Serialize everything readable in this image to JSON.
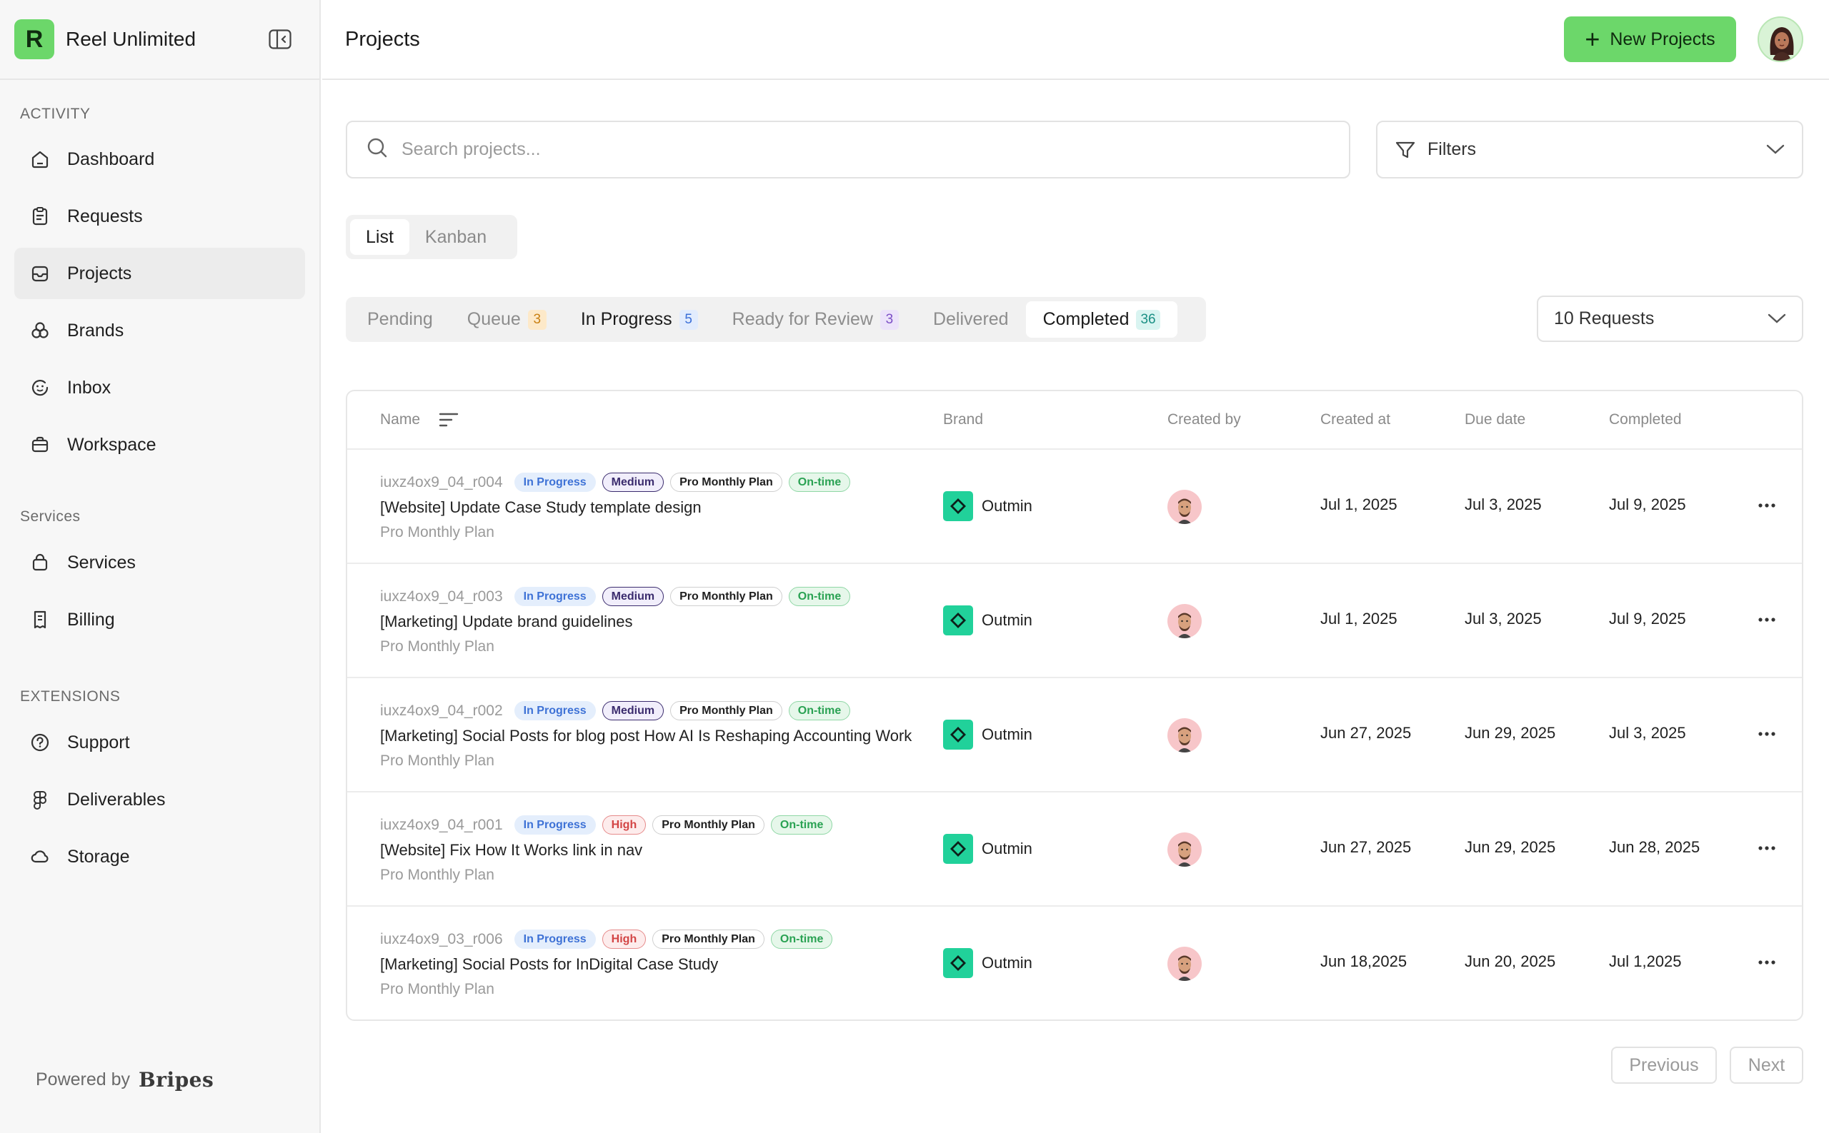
{
  "app": {
    "name": "Reel Unlimited",
    "logo_letter": "R"
  },
  "sidebar": {
    "sections": [
      {
        "label": "ACTIVITY",
        "items": [
          {
            "label": "Dashboard",
            "icon": "home-icon"
          },
          {
            "label": "Requests",
            "icon": "clipboard-icon"
          },
          {
            "label": "Projects",
            "icon": "inbox-tray-icon",
            "active": true
          },
          {
            "label": "Brands",
            "icon": "brand-circles-icon"
          },
          {
            "label": "Inbox",
            "icon": "smile-chat-icon"
          },
          {
            "label": "Workspace",
            "icon": "briefcase-icon"
          }
        ]
      },
      {
        "label": "Services",
        "items": [
          {
            "label": "Services",
            "icon": "bag-icon"
          },
          {
            "label": "Billing",
            "icon": "receipt-icon"
          }
        ]
      },
      {
        "label": "EXTENSIONS",
        "items": [
          {
            "label": "Support",
            "icon": "help-circle-icon"
          },
          {
            "label": "Deliverables",
            "icon": "figma-icon"
          },
          {
            "label": "Storage",
            "icon": "cloud-icon"
          }
        ]
      }
    ],
    "powered_by": "Powered by",
    "powered_brand": "Bripes"
  },
  "header": {
    "title": "Projects",
    "new_button": "New Projects"
  },
  "search": {
    "placeholder": "Search projects..."
  },
  "filters": {
    "label": "Filters"
  },
  "view_toggle": {
    "list": "List",
    "kanban": "Kanban",
    "selected": "List"
  },
  "tabs": [
    {
      "label": "Pending",
      "count": ""
    },
    {
      "label": "Queue",
      "count": "3",
      "color": "#c98012"
    },
    {
      "label": "In Progress",
      "count": "5",
      "color": "#3b6fd8"
    },
    {
      "label": "Ready for Review",
      "count": "3",
      "color": "#7c4fc6"
    },
    {
      "label": "Delivered",
      "count": ""
    },
    {
      "label": "Completed",
      "count": "36",
      "color": "#1a8f84",
      "selected": true
    }
  ],
  "per_page": {
    "value": "10 Requests"
  },
  "table": {
    "columns": {
      "name": "Name",
      "brand": "Brand",
      "created_by": "Created by",
      "created_at": "Created at",
      "due_date": "Due date",
      "completed": "Completed"
    },
    "rows": [
      {
        "id": "iuxz4ox9_04_r004",
        "status": "In Progress",
        "priority": "Medium",
        "plan_badge": "Pro Monthly Plan",
        "timing": "On-time",
        "title": "[Website] Update Case Study template design",
        "plan": "Pro Monthly Plan",
        "brand": "Outmin",
        "created_at": "Jul 1, 2025",
        "due_date": "Jul 3, 2025",
        "completed": "Jul 9, 2025"
      },
      {
        "id": "iuxz4ox9_04_r003",
        "status": "In Progress",
        "priority": "Medium",
        "plan_badge": "Pro Monthly Plan",
        "timing": "On-time",
        "title": "[Marketing] Update brand guidelines",
        "plan": "Pro Monthly Plan",
        "brand": "Outmin",
        "created_at": "Jul 1, 2025",
        "due_date": "Jul 3, 2025",
        "completed": "Jul 9, 2025"
      },
      {
        "id": "iuxz4ox9_04_r002",
        "status": "In Progress",
        "priority": "Medium",
        "plan_badge": "Pro Monthly Plan",
        "timing": "On-time",
        "title": "[Marketing] Social Posts for blog post How AI Is Reshaping Accounting Work",
        "plan": "Pro Monthly Plan",
        "brand": "Outmin",
        "created_at": "Jun 27, 2025",
        "due_date": "Jun 29, 2025",
        "completed": "Jul 3, 2025"
      },
      {
        "id": "iuxz4ox9_04_r001",
        "status": "In Progress",
        "priority": "High",
        "plan_badge": "Pro Monthly Plan",
        "timing": "On-time",
        "title": "[Website] Fix How It Works link in nav",
        "plan": "Pro Monthly Plan",
        "brand": "Outmin",
        "created_at": "Jun 27, 2025",
        "due_date": "Jun 29, 2025",
        "completed": "Jun 28, 2025"
      },
      {
        "id": "iuxz4ox9_03_r006",
        "status": "In Progress",
        "priority": "High",
        "plan_badge": "Pro Monthly Plan",
        "timing": "On-time",
        "title": "[Marketing] Social Posts for InDigital Case Study",
        "plan": "Pro Monthly Plan",
        "brand": "Outmin",
        "created_at": "Jun 18,2025",
        "due_date": "Jun 20, 2025",
        "completed": "Jul 1,2025"
      }
    ]
  },
  "pagination": {
    "previous": "Previous",
    "next": "Next"
  },
  "colors": {
    "accent": "#6cd76a",
    "brand_logo": "#21d19a"
  }
}
